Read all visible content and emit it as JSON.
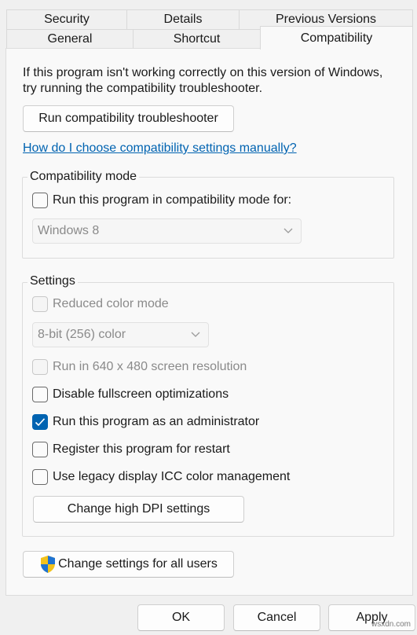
{
  "tabs_row1": [
    {
      "label": "Security"
    },
    {
      "label": "Details"
    },
    {
      "label": "Previous Versions"
    }
  ],
  "tabs_row2": [
    {
      "label": "General"
    },
    {
      "label": "Shortcut"
    },
    {
      "label": "Compatibility",
      "selected": true
    }
  ],
  "intro_text": "If this program isn't working correctly on this version of Windows, try running the compatibility troubleshooter.",
  "troubleshooter_button": "Run compatibility troubleshooter",
  "help_link": "How do I choose compatibility settings manually?",
  "compat_mode": {
    "title": "Compatibility mode",
    "checkbox_label": "Run this program in compatibility mode for:",
    "checked": false,
    "selected_os": "Windows 8"
  },
  "settings": {
    "title": "Settings",
    "reduced_color": {
      "label": "Reduced color mode",
      "checked": false,
      "disabled": true
    },
    "color_select": "8-bit (256) color",
    "res_640": {
      "label": "Run in 640 x 480 screen resolution",
      "checked": false,
      "disabled": true
    },
    "disable_fullscreen": {
      "label": "Disable fullscreen optimizations",
      "checked": false
    },
    "run_admin": {
      "label": "Run this program as an administrator",
      "checked": true
    },
    "register_restart": {
      "label": "Register this program for restart",
      "checked": false
    },
    "legacy_icc": {
      "label": "Use legacy display ICC color management",
      "checked": false
    },
    "dpi_button": "Change high DPI settings"
  },
  "all_users_button": "Change settings for all users",
  "footer": {
    "ok": "OK",
    "cancel": "Cancel",
    "apply": "Apply"
  },
  "watermark": "wsxdn.com",
  "colors": {
    "accent": "#0063b1",
    "link": "#0063b1"
  }
}
